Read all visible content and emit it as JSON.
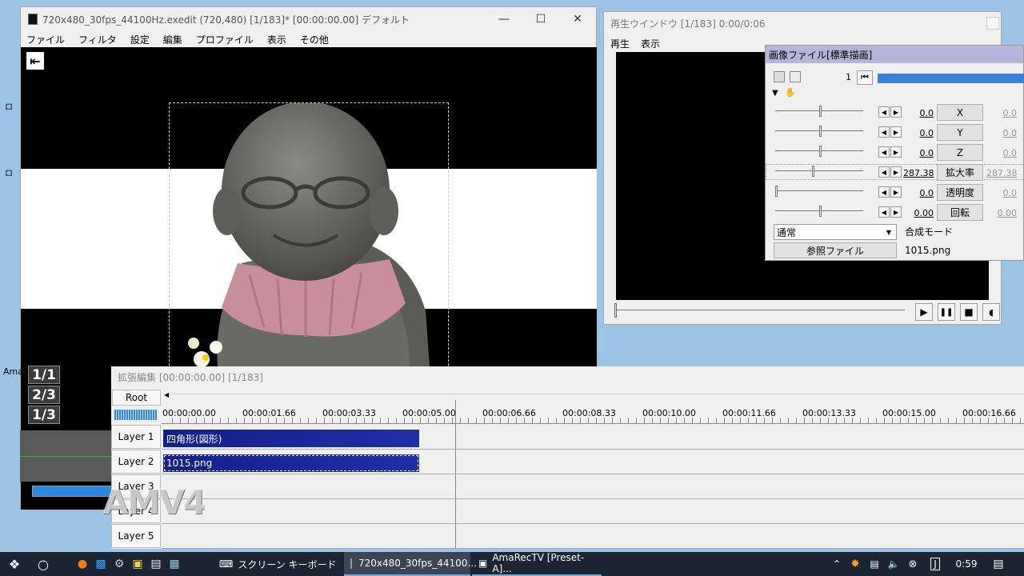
{
  "main_window": {
    "title": "720x480_30fps_44100Hz.exedit (720,480)  [1/183]* [00:00:00.00]  デフォルト",
    "menu": [
      "ファイル",
      "フィルタ",
      "設定",
      "編集",
      "プロファイル",
      "表示",
      "その他"
    ],
    "zoom_levels": [
      "1/1",
      "2/3",
      "1/3"
    ]
  },
  "side_labels": [
    "ロ",
    "ロ",
    "Ama"
  ],
  "playback_window": {
    "title": "再生ウインドウ [1/183]  0:00/0:06",
    "menu": [
      "再生",
      "表示"
    ]
  },
  "props_panel": {
    "title": "画像ファイル[標準描画]",
    "frame": "1",
    "params": [
      {
        "name": "X",
        "value": "0.0",
        "end_value": "0.0",
        "level": 0.5
      },
      {
        "name": "Y",
        "value": "0.0",
        "end_value": "0.0",
        "level": 0.5
      },
      {
        "name": "Z",
        "value": "0.0",
        "end_value": "0.0",
        "level": 0.5
      },
      {
        "name": "拡大率",
        "value": "287.38",
        "end_value": "287.38",
        "level": 0.42
      },
      {
        "name": "透明度",
        "value": "0.0",
        "end_value": "0.0",
        "level": 0.0
      },
      {
        "name": "回転",
        "value": "0.00",
        "end_value": "0.00",
        "level": 0.5
      }
    ],
    "blend_mode_value": "通常",
    "blend_mode_label": "合成モード",
    "ref_file_button": "参照ファイル",
    "ref_file_name": "1015.png"
  },
  "timeline": {
    "title": "拡張編集 [00:00:00.00] [1/183]",
    "root_label": "Root",
    "ticks": [
      "00:00:00.00",
      "00:00:01.66",
      "00:00:03.33",
      "00:00:05.00",
      "00:00:06.66",
      "00:00:08.33",
      "00:00:10.00",
      "00:00:11.66",
      "00:00:13.33",
      "00:00:15.00",
      "00:00:16.66"
    ],
    "layers": [
      "Layer 1",
      "Layer 2",
      "Layer 3",
      "Layer 4",
      "Layer 5"
    ],
    "clips": [
      {
        "layer": 1,
        "label": "四角形(図形)",
        "color": "#1f2fa6"
      },
      {
        "layer": 2,
        "label": "1015.png",
        "color": "#1f2fa6"
      }
    ]
  },
  "taskbar": {
    "items": [
      "スクリーン キーボード",
      "720x480_30fps_44100...",
      "AmaRecTV  [Preset-A]..."
    ],
    "clock": "0:59"
  },
  "watermark": "AMV4",
  "colors": {
    "accent_blue": "#3b82d6",
    "clip_blue": "#1f2fa6",
    "desktop": "#9cc4e4",
    "taskbar": "#1b2533"
  }
}
